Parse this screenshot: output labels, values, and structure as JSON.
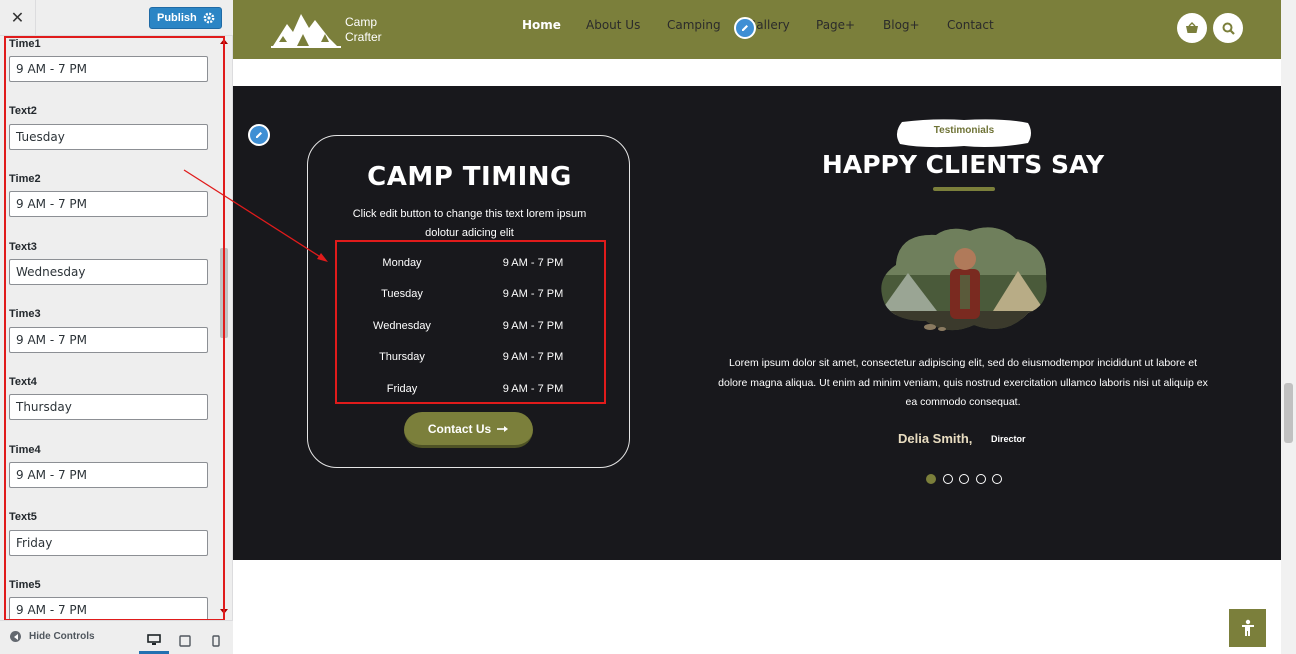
{
  "customizer": {
    "publish_label": "Publish",
    "fields": [
      {
        "label": "Time1",
        "value": "9 AM - 7 PM"
      },
      {
        "label": "Text2",
        "value": "Tuesday"
      },
      {
        "label": "Time2",
        "value": "9 AM - 7 PM"
      },
      {
        "label": "Text3",
        "value": "Wednesday"
      },
      {
        "label": "Time3",
        "value": "9 AM - 7 PM"
      },
      {
        "label": "Text4",
        "value": "Thursday"
      },
      {
        "label": "Time4",
        "value": "9 AM - 7 PM"
      },
      {
        "label": "Text5",
        "value": "Friday"
      },
      {
        "label": "Time5",
        "value": "9 AM - 7 PM"
      }
    ],
    "hide_controls_label": "Hide Controls"
  },
  "site": {
    "logo_line1": "Camp",
    "logo_line2": "Crafter",
    "nav": [
      "Home",
      "About Us",
      "Camping",
      "Gallery",
      "Page+",
      "Blog+",
      "Contact"
    ],
    "accent": "#7b7f3b"
  },
  "timing": {
    "title": "CAMP TIMING",
    "desc_line1": "Click edit button to change this text lorem ipsum",
    "desc_line2": "dolotur adicing elit",
    "rows": [
      {
        "day": "Monday",
        "hours": "9 AM - 7 PM"
      },
      {
        "day": "Tuesday",
        "hours": "9 AM - 7 PM"
      },
      {
        "day": "Wednesday",
        "hours": "9 AM - 7 PM"
      },
      {
        "day": "Thursday",
        "hours": "9 AM - 7 PM"
      },
      {
        "day": "Friday",
        "hours": "9 AM - 7 PM"
      }
    ],
    "contact_label": "Contact Us"
  },
  "testimonials": {
    "badge": "Testimonials",
    "title": "HAPPY CLIENTS SAY",
    "text_line1": "Lorem ipsum dolor sit amet, consectetur adipiscing elit, sed do eiusmodtempor incididunt ut labore et",
    "text_line2": "dolore magna aliqua. Ut enim ad minim veniam, quis nostrud exercitation ullamco laboris nisi ut aliquip ex",
    "text_line3": "ea commodo consequat.",
    "author": "Delia Smith,",
    "role": "Director",
    "slide_count": 5,
    "active_slide": 1
  }
}
